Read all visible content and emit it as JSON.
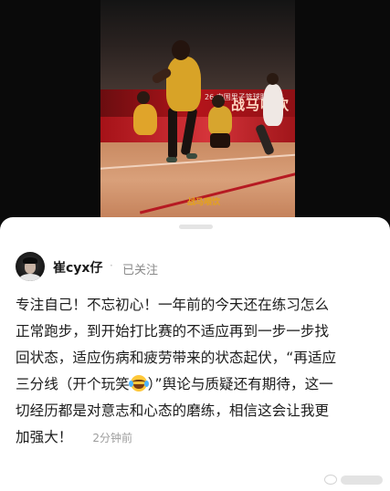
{
  "media": {
    "banner_text": "战马喂饮",
    "banner_small": "26 中国男子篮球职业",
    "court_logo": "战马喂饮"
  },
  "comment": {
    "username": "崔cyx仔",
    "separator": "·",
    "follow_status": "已关注",
    "lines": [
      "专注自己！不忘初心！一年前的今天还在练习怎么",
      "正常跑步，到开始打比赛的不适应再到一步一步找",
      "回状态，适应伤病和疲劳带来的状态起伏，“再适应",
      "三分线（开个玩笑",
      "）”舆论与质疑还有期待，这一",
      "切经历都是对意志和心态的磨练，相信这会让我更",
      "加强大！"
    ],
    "timestamp": "2分钟前",
    "emoji_icon": "laughing-tears-emoji"
  },
  "colors": {
    "sheet_bg": "#ffffff",
    "text_primary": "#1c1c1c",
    "text_secondary": "#8a8a8a"
  }
}
